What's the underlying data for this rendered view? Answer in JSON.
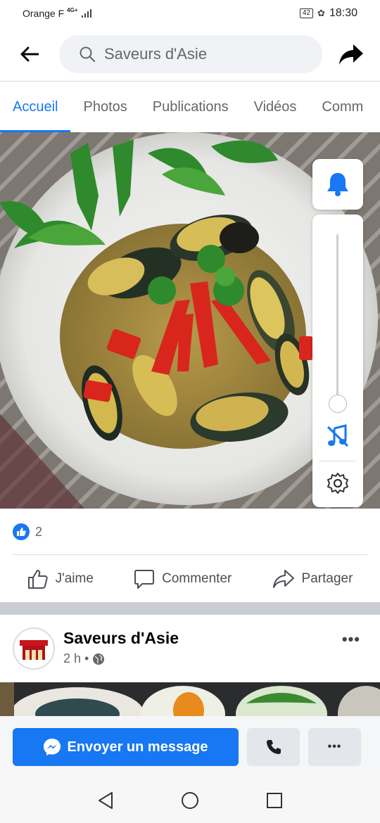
{
  "status_bar": {
    "carrier": "Orange F",
    "network": "4G+",
    "battery": "42",
    "time": "18:30"
  },
  "header": {
    "search_text": "Saveurs d'Asie",
    "icons": [
      "back-arrow-icon",
      "search-icon",
      "share-arrow-icon"
    ]
  },
  "tabs": [
    {
      "label": "Accueil",
      "active": true
    },
    {
      "label": "Photos",
      "active": false
    },
    {
      "label": "Publications",
      "active": false
    },
    {
      "label": "Vidéos",
      "active": false
    },
    {
      "label": "Comm",
      "active": false
    }
  ],
  "media_controls": {
    "icons": [
      "bell-icon",
      "music-off-icon",
      "gear-icon"
    ]
  },
  "reactions": {
    "count": "2"
  },
  "actions": {
    "like": "J'aime",
    "comment": "Commenter",
    "share": "Partager"
  },
  "post": {
    "page_name": "Saveurs d'Asie",
    "time": "2 h",
    "separator": "•",
    "more": "•••"
  },
  "bottom": {
    "message_button": "Envoyer un message",
    "more": "•••"
  },
  "colors": {
    "accent": "#1877f2",
    "text_secondary": "#65676b"
  }
}
